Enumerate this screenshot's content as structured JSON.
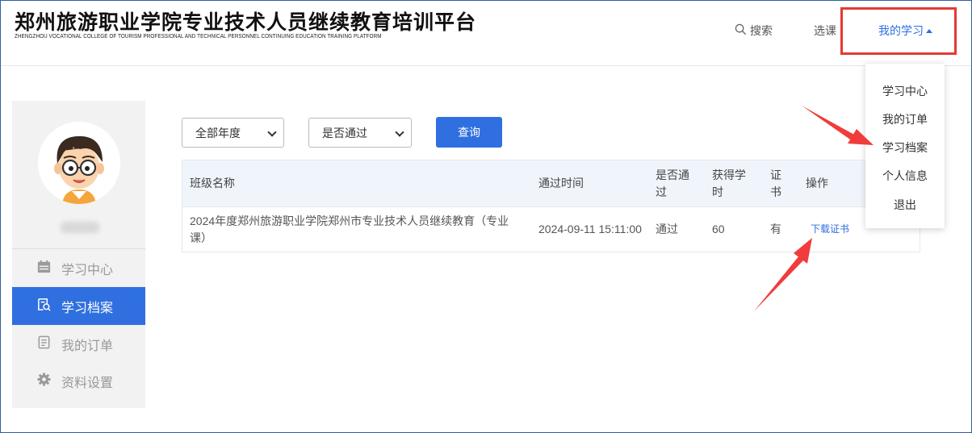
{
  "header": {
    "title": "郑州旅游职业学院专业技术人员继续教育培训平台",
    "subtitle": "ZHENGZHOU VOCATIONAL COLLEGE OF TOURISM PROFESSIONAL AND TECHNICAL PERSONNEL CONTINUING EDUCATION TRAINING PLATFORM",
    "nav": {
      "search_label": "搜索",
      "course_label": "选课",
      "mystudy_label": "我的学习"
    }
  },
  "dropdown": {
    "items": [
      "学习中心",
      "我的订单",
      "学习档案",
      "个人信息",
      "退出"
    ]
  },
  "sidebar": {
    "items": [
      {
        "label": "学习中心",
        "icon": "calendar-icon",
        "active": false
      },
      {
        "label": "学习档案",
        "icon": "archive-icon",
        "active": true
      },
      {
        "label": "我的订单",
        "icon": "document-icon",
        "active": false
      },
      {
        "label": "资料设置",
        "icon": "gear-icon",
        "active": false
      }
    ]
  },
  "filters": {
    "year_select": "全部年度",
    "pass_select": "是否通过",
    "query_button": "查询"
  },
  "table": {
    "headers": {
      "class_name": "班级名称",
      "pass_time": "通过时间",
      "passed": "是否通过",
      "hours": "获得学时",
      "certificate": "证书",
      "action": "操作"
    },
    "rows": [
      {
        "class_name": "2024年度郑州旅游职业学院郑州市专业技术人员继续教育（专业课）",
        "pass_time": "2024-09-11 15:11:00",
        "passed": "通过",
        "hours": "60",
        "certificate": "有",
        "action": "下载证书"
      }
    ]
  },
  "colors": {
    "accent": "#2f6fe0",
    "annotation": "#e53935",
    "sidebar_bg": "#f2f2f2",
    "table_header_bg": "#f0f5fc"
  }
}
